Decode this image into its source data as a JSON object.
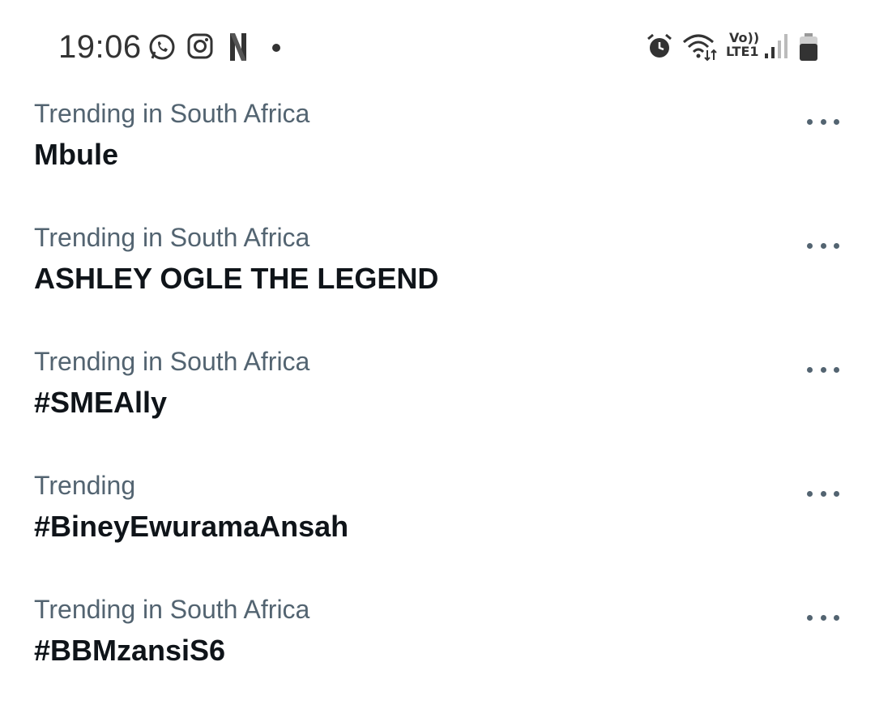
{
  "status_bar": {
    "time": "19:06",
    "volte_top": "Vo))",
    "volte_bottom": "LTE1",
    "icons": [
      "whatsapp-icon",
      "instagram-icon",
      "netflix-icon",
      "notification-dot",
      "alarm-icon",
      "wifi-icon",
      "signal-icon",
      "battery-icon"
    ]
  },
  "trends": [
    {
      "context": "Trending in South Africa",
      "title": "Mbule"
    },
    {
      "context": "Trending in South Africa",
      "title": "ASHLEY OGLE THE LEGEND"
    },
    {
      "context": "Trending in South Africa",
      "title": "#SMEAlly"
    },
    {
      "context": "Trending",
      "title": "#BineyEwuramaAnsah"
    },
    {
      "context": "Trending in South Africa",
      "title": "#BBMzansiS6"
    }
  ],
  "colors": {
    "context_text": "#536471",
    "title_text": "#0f1419"
  }
}
